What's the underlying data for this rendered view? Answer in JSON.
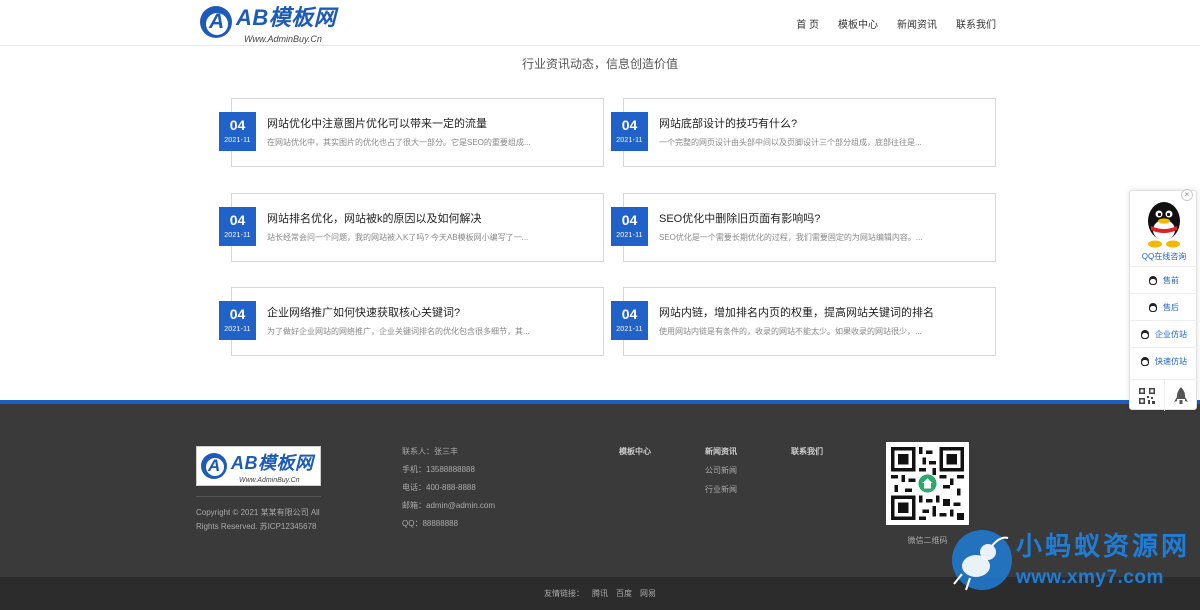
{
  "header": {
    "logo_main": "AB模板网",
    "logo_sub": "Www.AdminBuy.Cn",
    "nav": [
      "首 页",
      "模板中心",
      "新闻资讯",
      "联系我们"
    ]
  },
  "slogan": "行业资讯动态，信息创造价值",
  "news": [
    {
      "day": "04",
      "ym": "2021-11",
      "title": "网站优化中注意图片优化可以带来一定的流量",
      "desc": "在网站优化中，其实图片的优化也占了很大一部分。它是SEO的重要组成..."
    },
    {
      "day": "04",
      "ym": "2021-11",
      "title": "网站底部设计的技巧有什么?",
      "desc": "一个完整的网页设计由头部中间以及页脚设计三个部分组成，底部往往是..."
    },
    {
      "day": "04",
      "ym": "2021-11",
      "title": "网站排名优化，网站被k的原因以及如何解决",
      "desc": "站长经常会问一个问题，我的网站被入K了吗? 今天AB模板网小编写了一..."
    },
    {
      "day": "04",
      "ym": "2021-11",
      "title": "SEO优化中删除旧页面有影响吗?",
      "desc": "SEO优化是一个需要长期优化的过程，我们需要固定的为网站编辑内容。..."
    },
    {
      "day": "04",
      "ym": "2021-11",
      "title": "企业网络推广如何快速获取核心关键词?",
      "desc": "为了做好企业网站的网络推广，企业关键词排名的优化包含很多细节，其..."
    },
    {
      "day": "04",
      "ym": "2021-11",
      "title": "网站内链，增加排名内页的权重，提高网站关键词的排名",
      "desc": "使用网站内链是有条件的，收录的网站不能太少。如果收录的网站很少，..."
    }
  ],
  "footer": {
    "logo_main": "AB模板网",
    "logo_sub": "Www.AdminBuy.Cn",
    "copyright": "Copyright © 2021 某某有限公司 All Rights Reserved. 苏ICP12345678",
    "contact": {
      "person": "联系人：张三丰",
      "mobile": "手机：13588888888",
      "phone": "电话：400-888-8888",
      "email": "邮箱：admin@admin.com",
      "qq": "QQ：88888888"
    },
    "col_templates": "模板中心",
    "col_news": "新闻资讯",
    "col_news_links": [
      "公司新闻",
      "行业新闻"
    ],
    "col_contact": "联系我们",
    "qr_caption": "微信二维码"
  },
  "friend_links": {
    "label": "友情链接：",
    "links": [
      "腾讯",
      "百度",
      "网易"
    ]
  },
  "float_panel": {
    "caption": "QQ在线咨询",
    "items": [
      "售前",
      "售后",
      "企业仿站",
      "快速仿站"
    ]
  },
  "watermark": {
    "line1": "小蚂蚁资源网",
    "line2": "www.xmy7.com"
  },
  "colors": {
    "accent": "#2062c7",
    "footer_bg": "#3a3a3a",
    "copybar_bg": "#2c2c2c"
  }
}
